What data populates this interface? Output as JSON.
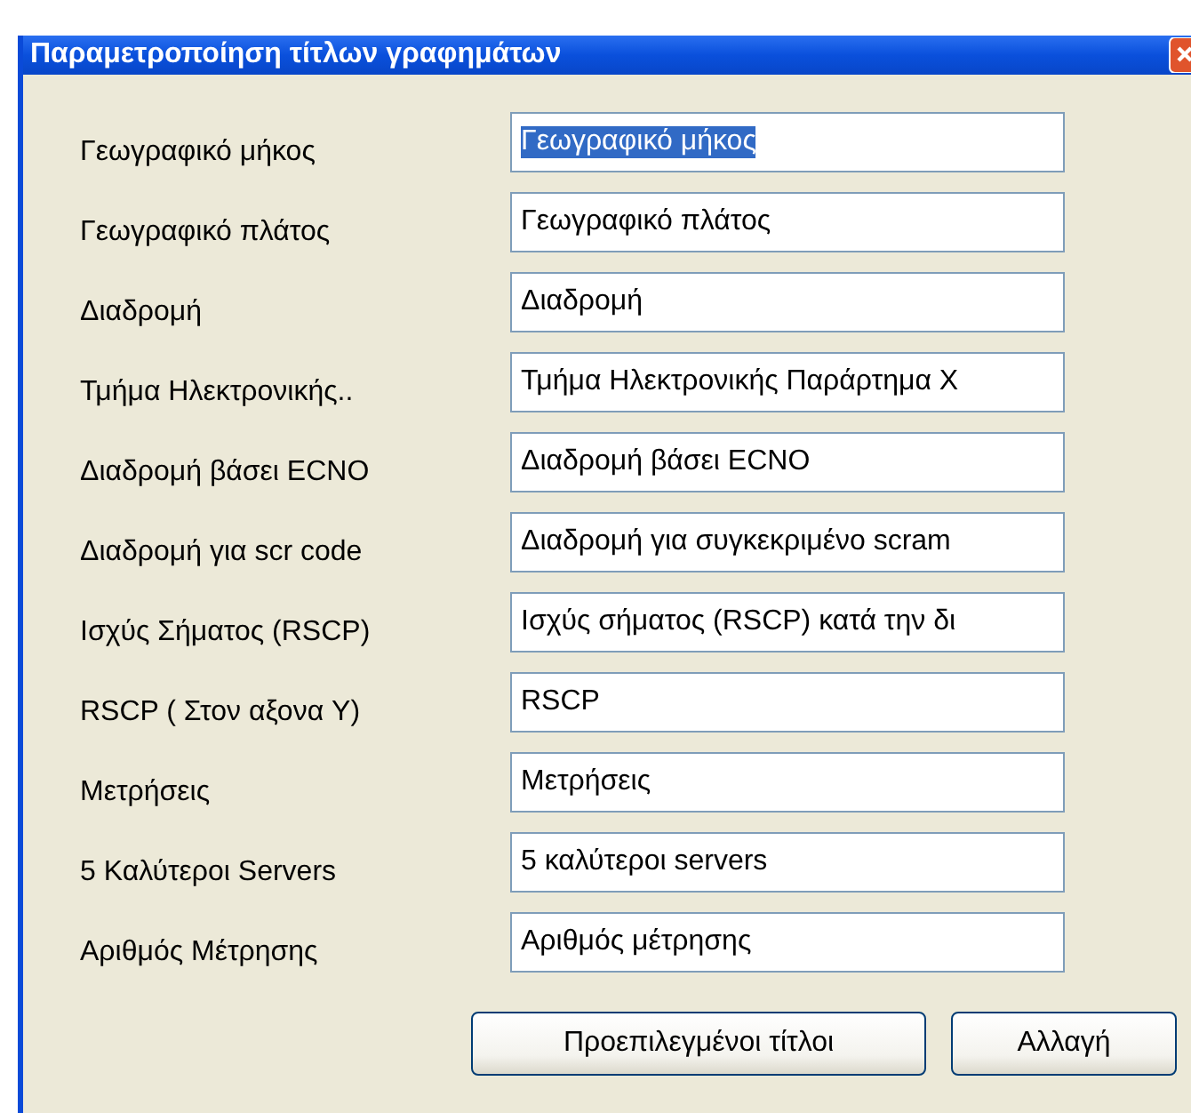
{
  "window": {
    "title": "Παραμετροποίηση τίτλων γραφημάτων"
  },
  "fields": [
    {
      "label": "Γεωγραφικό μήκος",
      "value": "Γεωγραφικό μήκος",
      "text_selected": true
    },
    {
      "label": "Γεωγραφικό πλάτος",
      "value": "Γεωγραφικό πλάτος",
      "text_selected": false
    },
    {
      "label": "Διαδρομή",
      "value": "Διαδρομή",
      "text_selected": false
    },
    {
      "label": "Τμήμα Ηλεκτρονικής..",
      "value": "Τμήμα Ηλεκτρονικής Παράρτημα Χ",
      "text_selected": false
    },
    {
      "label": "Διαδρομή βάσει ECNO",
      "value": "Διαδρομή βάσει ECNO",
      "text_selected": false
    },
    {
      "label": "Διαδρομή για scr code",
      "value": "Διαδρομή για συγκεκριμένο scram",
      "text_selected": false
    },
    {
      "label": "Ισχύς Σήματος (RSCP)",
      "value": "Ισχύς σήματος (RSCP) κατά την δι",
      "text_selected": false
    },
    {
      "label": "RSCP ( Στον αξονα Y)",
      "value": "RSCP",
      "text_selected": false
    },
    {
      "label": "Μετρήσεις",
      "value": "Μετρήσεις",
      "text_selected": false
    },
    {
      "label": "5 Καλύτεροι Servers",
      "value": "5 καλύτεροι servers",
      "text_selected": false
    },
    {
      "label": "Αριθμός Μέτρησης",
      "value": "Αριθμός μέτρησης",
      "text_selected": false
    }
  ],
  "buttons": [
    "Προεπιλεγμένοι τίτλοι",
    "Αλλαγή"
  ]
}
